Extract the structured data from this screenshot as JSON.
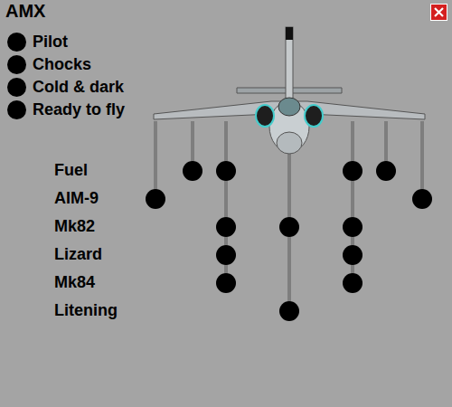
{
  "window": {
    "title": "AMX"
  },
  "checklist": [
    {
      "label": "Pilot",
      "done": false
    },
    {
      "label": "Chocks",
      "done": false
    },
    {
      "label": "Cold & dark",
      "done": false
    },
    {
      "label": "Ready to fly",
      "done": false
    }
  ],
  "stores": [
    "Fuel",
    "AIM-9",
    "Mk82",
    "Lizard",
    "Mk84",
    "Litening"
  ],
  "stations": [
    {
      "stores": [
        "AIM-9"
      ]
    },
    {
      "stores": [
        "Fuel"
      ]
    },
    {
      "stores": [
        "Fuel",
        "Mk82",
        "Lizard",
        "Mk84"
      ]
    },
    {
      "stores": [
        "Mk82",
        "Litening"
      ]
    },
    {
      "stores": [
        "Fuel",
        "Mk82",
        "Lizard",
        "Mk84"
      ]
    },
    {
      "stores": [
        "Fuel"
      ]
    },
    {
      "stores": [
        "AIM-9"
      ]
    }
  ]
}
